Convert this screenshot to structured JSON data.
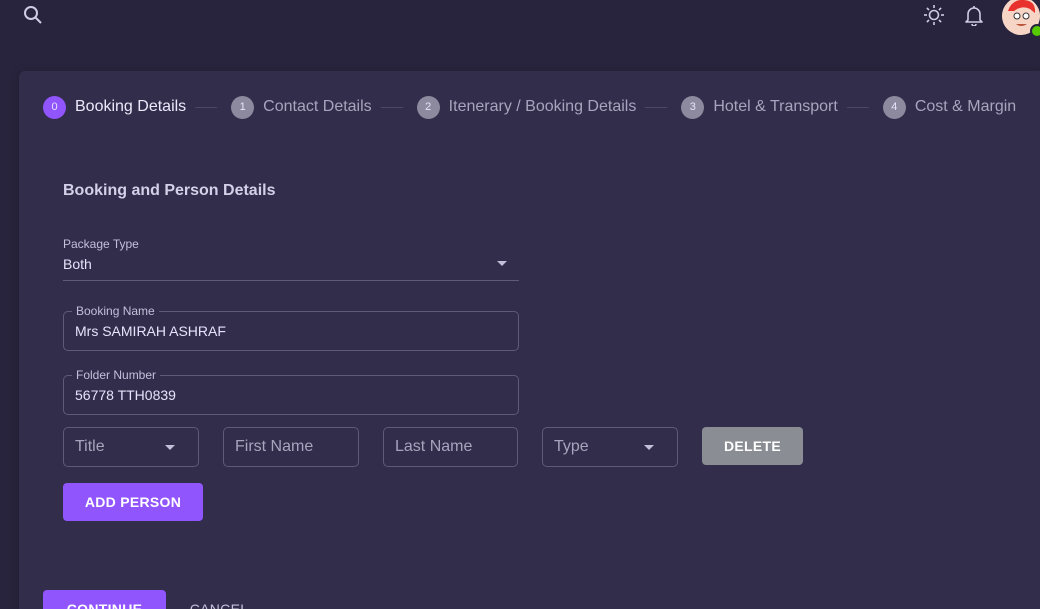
{
  "topbar": {
    "search_icon": "search-icon",
    "theme_icon": "sun-icon",
    "notification_icon": "bell-icon"
  },
  "stepper": {
    "steps": [
      {
        "num": "0",
        "label": "Booking Details",
        "active": true
      },
      {
        "num": "1",
        "label": "Contact Details",
        "active": false
      },
      {
        "num": "2",
        "label": "Itenerary / Booking Details",
        "active": false
      },
      {
        "num": "3",
        "label": "Hotel & Transport",
        "active": false
      },
      {
        "num": "4",
        "label": "Cost & Margin",
        "active": false
      }
    ]
  },
  "form": {
    "section_title": "Booking and Person Details",
    "package_type": {
      "label": "Package Type",
      "value": "Both"
    },
    "booking_name": {
      "label": "Booking Name",
      "value": "Mrs SAMIRAH ASHRAF"
    },
    "folder_number": {
      "label": "Folder Number",
      "value": "56778 TTH0839"
    },
    "person": {
      "title_placeholder": "Title",
      "first_name_placeholder": "First Name",
      "last_name_placeholder": "Last Name",
      "type_placeholder": "Type",
      "delete_label": "DELETE"
    },
    "add_person_label": "ADD PERSON"
  },
  "actions": {
    "continue_label": "CONTINUE",
    "cancel_label": "CANCEL"
  },
  "colors": {
    "primary": "#9155fd",
    "background": "#28243d",
    "surface": "#312d4b",
    "secondary": "#8a8d93"
  }
}
